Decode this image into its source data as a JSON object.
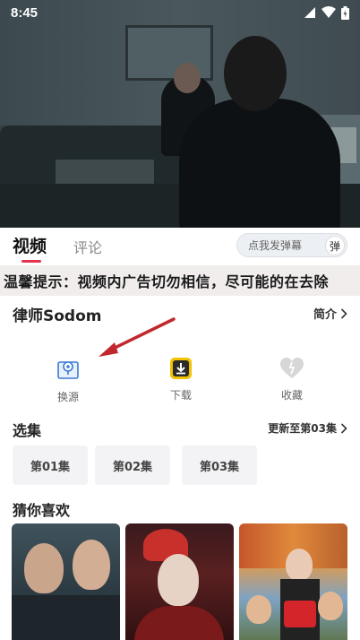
{
  "status_bar": {
    "time": "8:45"
  },
  "tabs": {
    "video": "视频",
    "comment": "评论"
  },
  "danmaku": {
    "placeholder": "点我发弹幕",
    "toggle": "弹"
  },
  "notice": "温馨提示：视频内广告切勿相信，尽可能的在去除",
  "title": "律师Sodom",
  "intro": "简介",
  "actions": {
    "source": "换源",
    "download": "下载",
    "favorite": "收藏"
  },
  "episodes": {
    "title": "选集",
    "update": "更新至第03集",
    "items": [
      "第01集",
      "第02集",
      "第03集"
    ]
  },
  "recommend": {
    "title": "猜你喜欢"
  },
  "colors": {
    "accent": "#e0344a",
    "arrow": "#c0282d",
    "download_icon": "#f2c200",
    "source_icon": "#3a7bd5"
  },
  "icons": [
    "signal-icon",
    "wifi-icon",
    "battery-icon",
    "chevron-right-icon",
    "source-icon",
    "download-icon",
    "favorite-icon"
  ]
}
